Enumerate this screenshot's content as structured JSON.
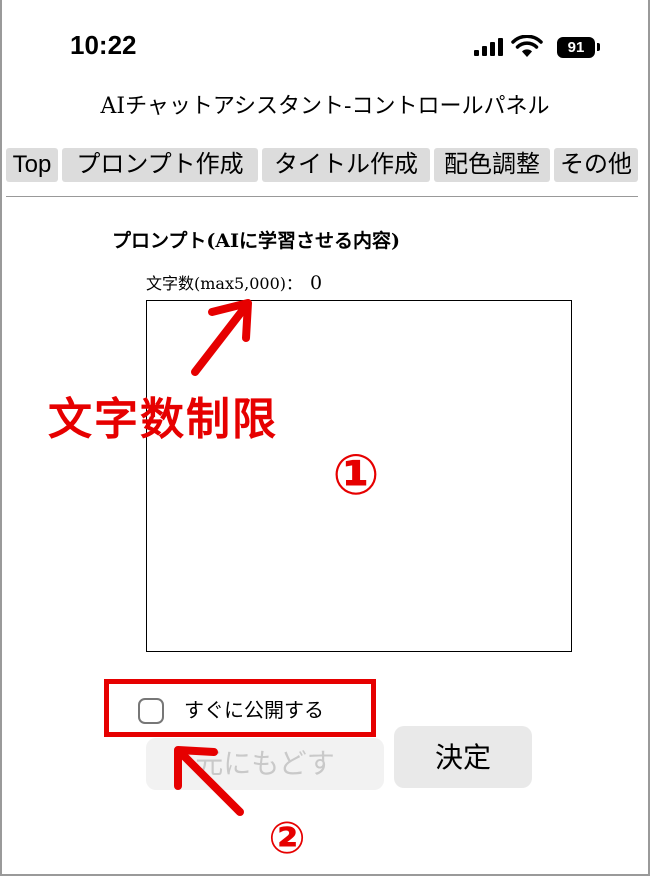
{
  "status_bar": {
    "time": "10:22",
    "battery": "91",
    "signal_icon": "cellular-signal-icon",
    "wifi_icon": "wifi-icon"
  },
  "app_title": "AIチャットアシスタント-コントロールパネル",
  "tabs": [
    {
      "label": "Top"
    },
    {
      "label": "プロンプト作成"
    },
    {
      "label": "タイトル作成"
    },
    {
      "label": "配色調整"
    },
    {
      "label": "その他"
    }
  ],
  "prompt_section": {
    "title": "プロンプト(AIに学習させる内容)",
    "char_count_label": "文字数(max5,000)：",
    "char_count_value": "0",
    "textarea_value": ""
  },
  "publish": {
    "label": "すぐに公開する",
    "checked": false
  },
  "buttons": {
    "reset": "元にもどす",
    "submit": "決定"
  },
  "annotations": {
    "char_limit_label": "文字数制限",
    "marker_1": "①",
    "marker_2": "②",
    "color": "#e60000"
  }
}
